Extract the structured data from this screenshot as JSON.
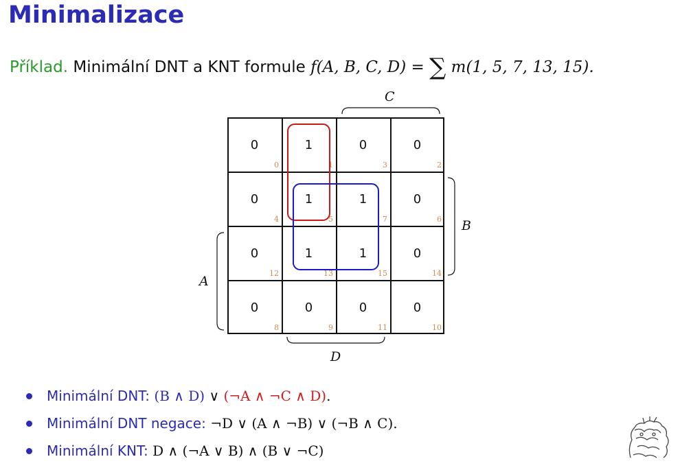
{
  "title": "Minimalizace",
  "example": {
    "lead": "Příklad.",
    "text": "Minimální DNT a KNT formule",
    "formula_lhs": "f(A, B, C, D) =",
    "sum_symbol": "∑",
    "formula_rhs": "m(1, 5, 7, 13, 15)."
  },
  "kmap": {
    "labels": {
      "C": "C",
      "B": "B",
      "A": "A",
      "D": "D"
    },
    "cells": [
      {
        "value": "0",
        "index": "0"
      },
      {
        "value": "1",
        "index": "1"
      },
      {
        "value": "0",
        "index": "3"
      },
      {
        "value": "0",
        "index": "2"
      },
      {
        "value": "0",
        "index": "4"
      },
      {
        "value": "1",
        "index": "5"
      },
      {
        "value": "1",
        "index": "7"
      },
      {
        "value": "0",
        "index": "6"
      },
      {
        "value": "0",
        "index": "12"
      },
      {
        "value": "1",
        "index": "13"
      },
      {
        "value": "1",
        "index": "15"
      },
      {
        "value": "0",
        "index": "14"
      },
      {
        "value": "0",
        "index": "8"
      },
      {
        "value": "0",
        "index": "9"
      },
      {
        "value": "0",
        "index": "11"
      },
      {
        "value": "0",
        "index": "10"
      }
    ],
    "colors": {
      "red_loop": "#c81818",
      "blue_loop": "#1a1ac8",
      "index_color": "#d38a4a"
    }
  },
  "bullets": [
    {
      "label": "Minimální DNT:",
      "part1": "(B ∧ D)",
      "op": " ∨ ",
      "part2": "(¬A ∧ ¬C ∧ D)",
      "end": "."
    },
    {
      "label": "Minimální DNT negace:",
      "formula": "¬D ∨ (A ∧ ¬B) ∨ (¬B ∧ C)."
    },
    {
      "label": "Minimální KNT:",
      "formula": "D ∧ (¬A ∨ B) ∧ (B ∨ ¬C)"
    }
  ],
  "colors": {
    "title": "#2b2bb5",
    "lead": "#2a9b2a",
    "red": "#d01c1c",
    "blue": "#2b2bb5"
  },
  "logo_icon": "ctu-lion-logo-icon"
}
